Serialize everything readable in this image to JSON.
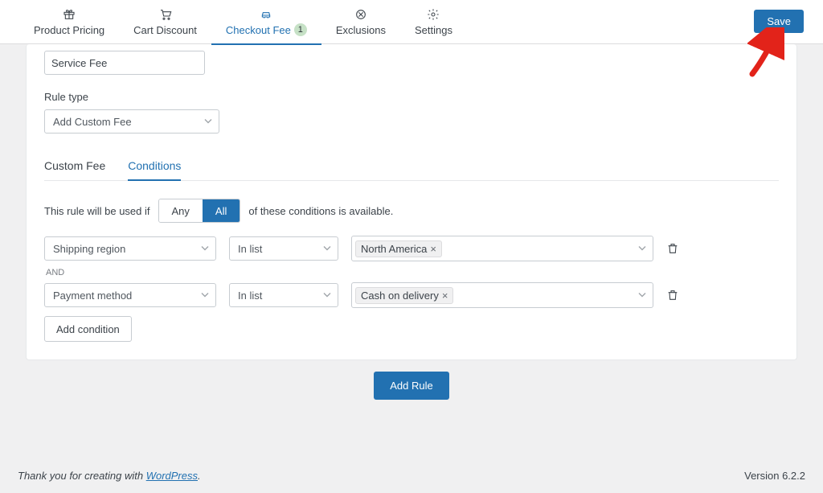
{
  "colors": {
    "accent": "#2271b1",
    "badge_bg": "#c6e1c6"
  },
  "nav": {
    "product_pricing": "Product Pricing",
    "cart_discount": "Cart Discount",
    "checkout_fee": "Checkout Fee",
    "checkout_fee_badge": "1",
    "exclusions": "Exclusions",
    "settings": "Settings",
    "save": "Save"
  },
  "rule": {
    "title_value": "Service Fee",
    "rule_type_label": "Rule type",
    "rule_type_value": "Add Custom Fee"
  },
  "subtabs": {
    "custom_fee": "Custom Fee",
    "conditions": "Conditions"
  },
  "conditions": {
    "prefix": "This rule will be used if",
    "any": "Any",
    "all": "All",
    "suffix": "of these conditions is available.",
    "and": "AND",
    "rows": [
      {
        "field": "Shipping region",
        "op": "In list",
        "tag": "North America"
      },
      {
        "field": "Payment method",
        "op": "In list",
        "tag": "Cash on delivery"
      }
    ],
    "add_condition": "Add condition"
  },
  "add_rule": "Add Rule",
  "footer": {
    "thanks_prefix": "Thank you for creating with ",
    "wp": "WordPress",
    "period": ".",
    "version": "Version 6.2.2"
  }
}
